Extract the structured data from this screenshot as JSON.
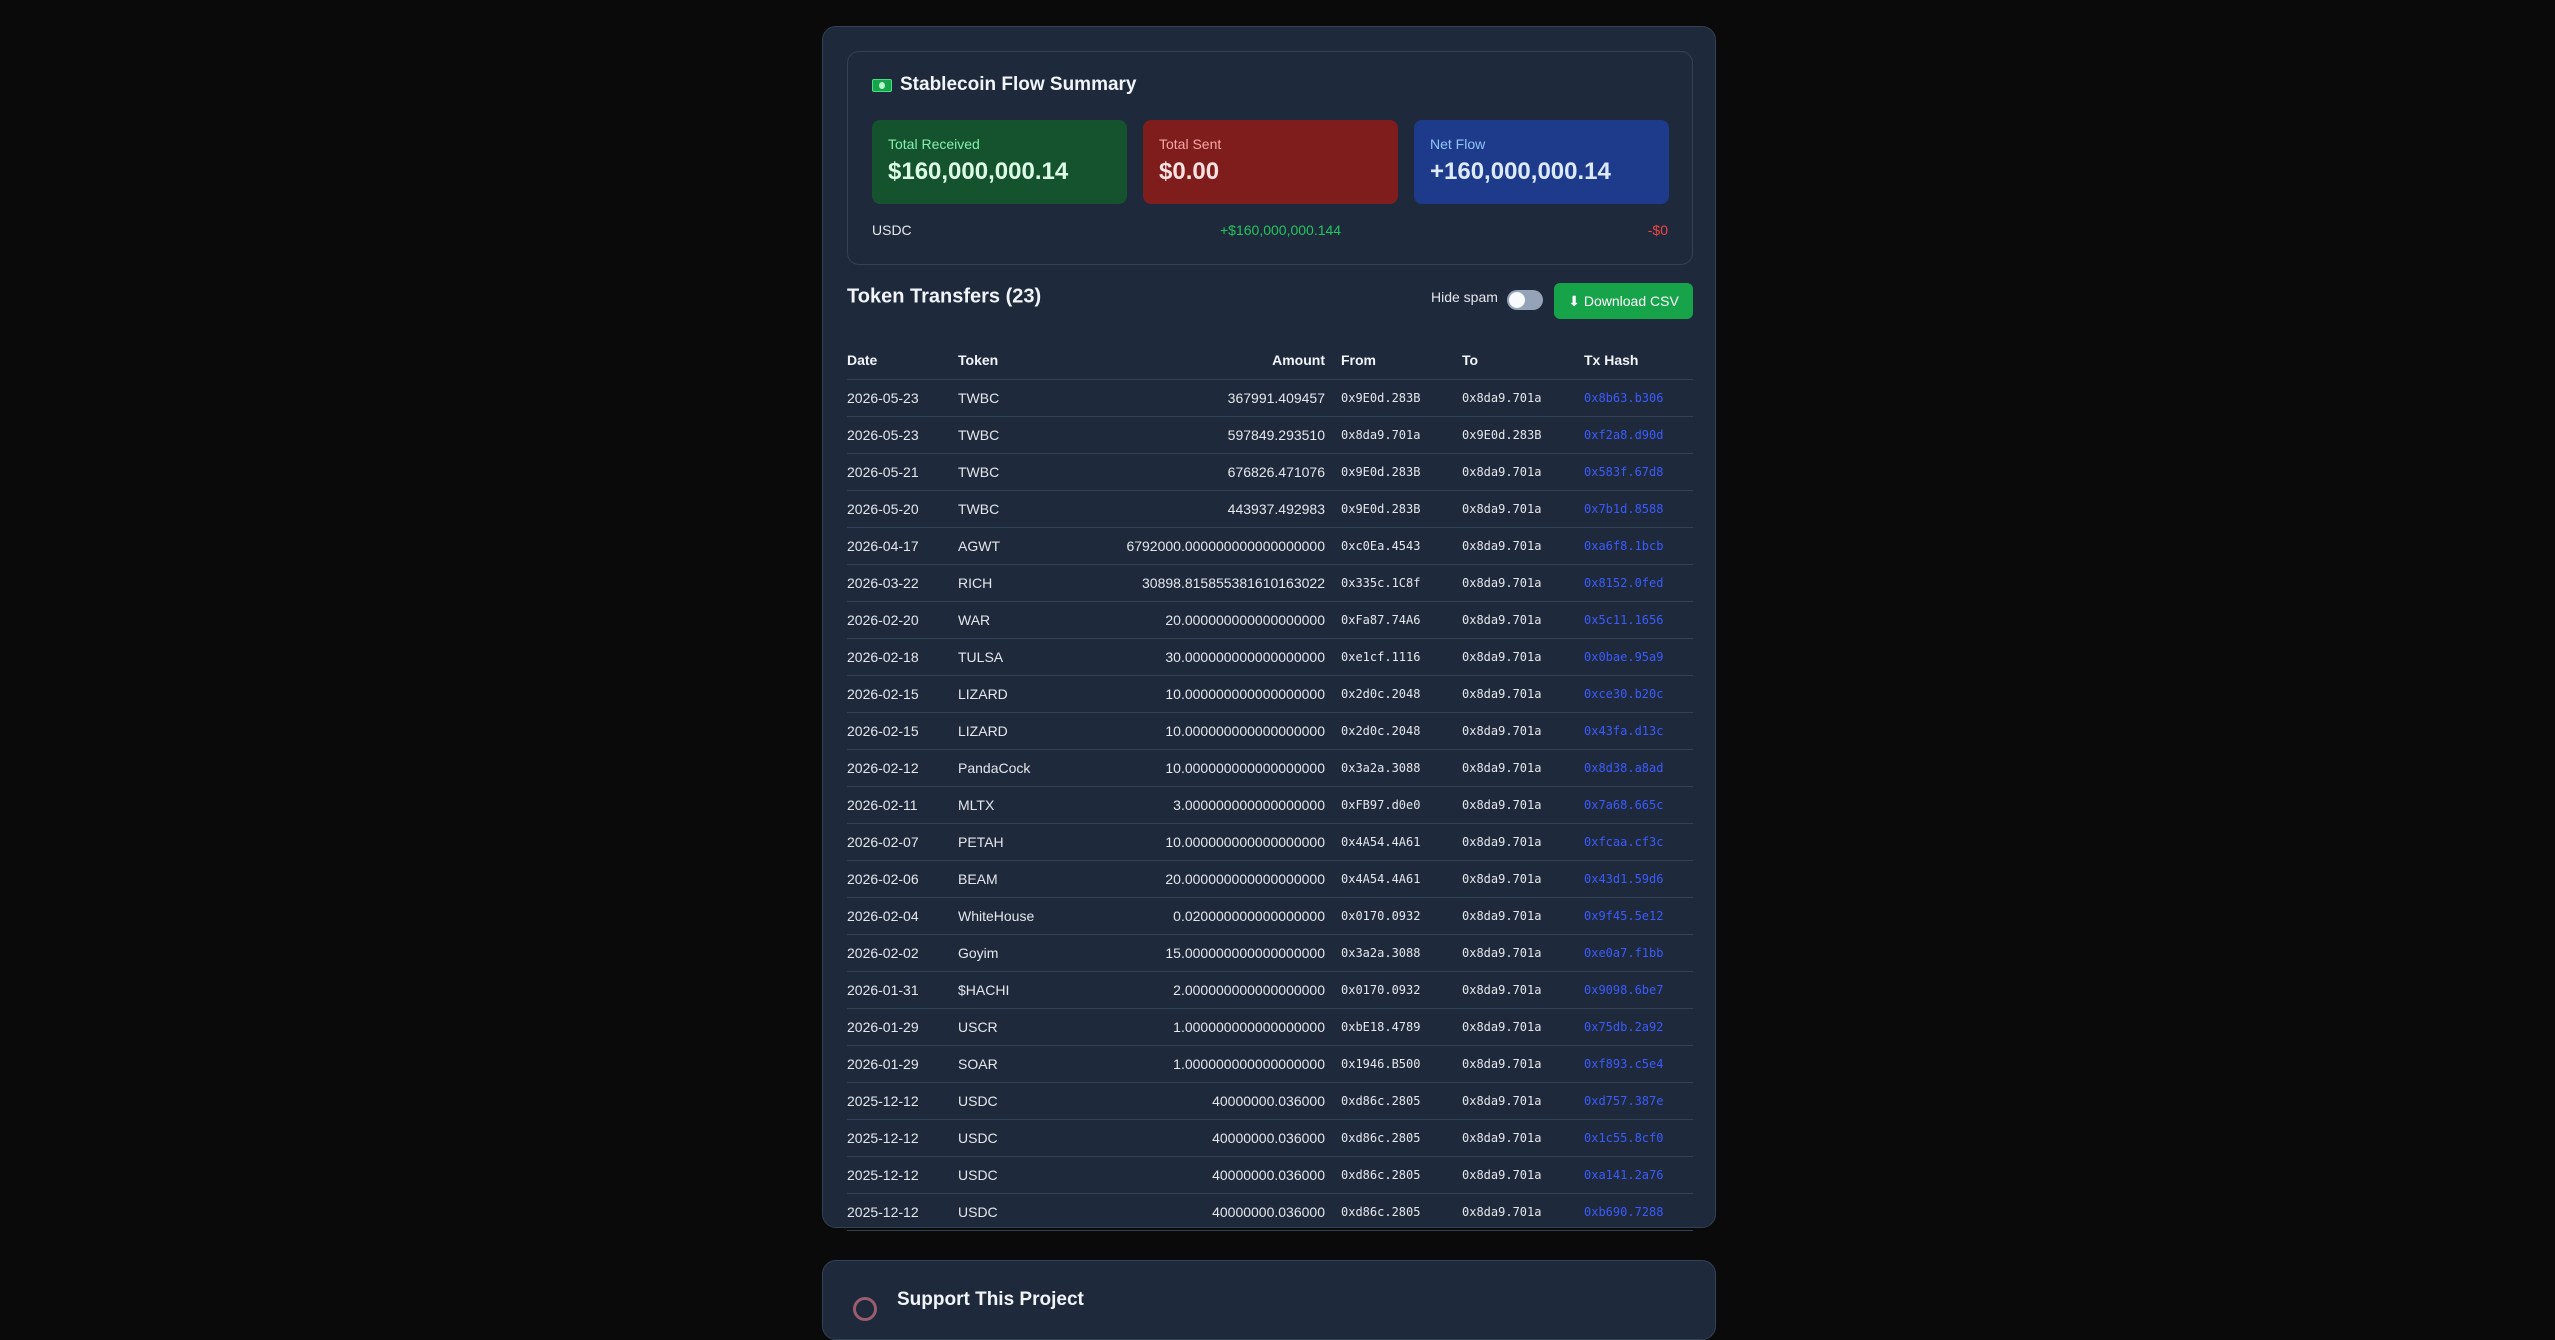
{
  "summary": {
    "title": "Stablecoin Flow Summary",
    "icon": "money-icon",
    "received": {
      "label": "Total Received",
      "value": "$160,000,000.14"
    },
    "sent": {
      "label": "Total Sent",
      "value": "$0.00"
    },
    "net": {
      "label": "Net Flow",
      "value": "+160,000,000.14"
    },
    "usdc": {
      "symbol": "USDC",
      "in": "+$160,000,000.144",
      "out": "-$0"
    }
  },
  "transfers": {
    "title": "Token Transfers (23)",
    "hide_spam_label": "Hide spam",
    "hide_spam_on": false,
    "download_label": "⬇ Download CSV",
    "columns": [
      "Date",
      "Token",
      "Amount",
      "From",
      "To",
      "Tx Hash"
    ],
    "rows": [
      {
        "date": "2026-05-23",
        "token": "TWBC",
        "amount": "367991.409457",
        "from": "0x9E0d.283B",
        "to": "0x8da9.701a",
        "hash": "0x8b63.b306"
      },
      {
        "date": "2026-05-23",
        "token": "TWBC",
        "amount": "597849.293510",
        "from": "0x8da9.701a",
        "to": "0x9E0d.283B",
        "hash": "0xf2a8.d90d"
      },
      {
        "date": "2026-05-21",
        "token": "TWBC",
        "amount": "676826.471076",
        "from": "0x9E0d.283B",
        "to": "0x8da9.701a",
        "hash": "0x583f.67d8"
      },
      {
        "date": "2026-05-20",
        "token": "TWBC",
        "amount": "443937.492983",
        "from": "0x9E0d.283B",
        "to": "0x8da9.701a",
        "hash": "0x7b1d.8588"
      },
      {
        "date": "2026-04-17",
        "token": "AGWT",
        "amount": "6792000.000000000000000000",
        "from": "0xc0Ea.4543",
        "to": "0x8da9.701a",
        "hash": "0xa6f8.1bcb"
      },
      {
        "date": "2026-03-22",
        "token": "RICH",
        "amount": "30898.815855381610163022",
        "from": "0x335c.1C8f",
        "to": "0x8da9.701a",
        "hash": "0x8152.0fed"
      },
      {
        "date": "2026-02-20",
        "token": "WAR",
        "amount": "20.000000000000000000",
        "from": "0xFa87.74A6",
        "to": "0x8da9.701a",
        "hash": "0x5c11.1656"
      },
      {
        "date": "2026-02-18",
        "token": "TULSA",
        "amount": "30.000000000000000000",
        "from": "0xe1cf.1116",
        "to": "0x8da9.701a",
        "hash": "0x0bae.95a9"
      },
      {
        "date": "2026-02-15",
        "token": "LIZARD",
        "amount": "10.000000000000000000",
        "from": "0x2d0c.2048",
        "to": "0x8da9.701a",
        "hash": "0xce30.b20c"
      },
      {
        "date": "2026-02-15",
        "token": "LIZARD",
        "amount": "10.000000000000000000",
        "from": "0x2d0c.2048",
        "to": "0x8da9.701a",
        "hash": "0x43fa.d13c"
      },
      {
        "date": "2026-02-12",
        "token": "PandaCock",
        "amount": "10.000000000000000000",
        "from": "0x3a2a.3088",
        "to": "0x8da9.701a",
        "hash": "0x8d38.a8ad"
      },
      {
        "date": "2026-02-11",
        "token": "MLTX",
        "amount": "3.000000000000000000",
        "from": "0xFB97.d0e0",
        "to": "0x8da9.701a",
        "hash": "0x7a68.665c"
      },
      {
        "date": "2026-02-07",
        "token": "PETAH",
        "amount": "10.000000000000000000",
        "from": "0x4A54.4A61",
        "to": "0x8da9.701a",
        "hash": "0xfcaa.cf3c"
      },
      {
        "date": "2026-02-06",
        "token": "BEAM",
        "amount": "20.000000000000000000",
        "from": "0x4A54.4A61",
        "to": "0x8da9.701a",
        "hash": "0x43d1.59d6"
      },
      {
        "date": "2026-02-04",
        "token": "WhiteHouse",
        "amount": "0.020000000000000000",
        "from": "0x0170.0932",
        "to": "0x8da9.701a",
        "hash": "0x9f45.5e12"
      },
      {
        "date": "2026-02-02",
        "token": "Goyim",
        "amount": "15.000000000000000000",
        "from": "0x3a2a.3088",
        "to": "0x8da9.701a",
        "hash": "0xe0a7.f1bb"
      },
      {
        "date": "2026-01-31",
        "token": "$HACHI",
        "amount": "2.000000000000000000",
        "from": "0x0170.0932",
        "to": "0x8da9.701a",
        "hash": "0x9098.6be7"
      },
      {
        "date": "2026-01-29",
        "token": "USCR",
        "amount": "1.000000000000000000",
        "from": "0xbE18.4789",
        "to": "0x8da9.701a",
        "hash": "0x75db.2a92"
      },
      {
        "date": "2026-01-29",
        "token": "SOAR",
        "amount": "1.000000000000000000",
        "from": "0x1946.B500",
        "to": "0x8da9.701a",
        "hash": "0xf893.c5e4"
      },
      {
        "date": "2025-12-12",
        "token": "USDC",
        "amount": "40000000.036000",
        "from": "0xd86c.2805",
        "to": "0x8da9.701a",
        "hash": "0xd757.387e"
      },
      {
        "date": "2025-12-12",
        "token": "USDC",
        "amount": "40000000.036000",
        "from": "0xd86c.2805",
        "to": "0x8da9.701a",
        "hash": "0x1c55.8cf0"
      },
      {
        "date": "2025-12-12",
        "token": "USDC",
        "amount": "40000000.036000",
        "from": "0xd86c.2805",
        "to": "0x8da9.701a",
        "hash": "0xa141.2a76"
      },
      {
        "date": "2025-12-12",
        "token": "USDC",
        "amount": "40000000.036000",
        "from": "0xd86c.2805",
        "to": "0x8da9.701a",
        "hash": "0xb690.7288"
      }
    ]
  },
  "support": {
    "title": "Support This Project",
    "icon": "heart-icon"
  },
  "colors": {
    "background": "#0a0a0a",
    "panel": "#1e293b",
    "received_card": "#14532d",
    "sent_card": "#7f1d1d",
    "net_card": "#1e3a8a",
    "download_button": "#16a34a",
    "hash_link": "#3b5bfd",
    "positive": "#22c55e",
    "negative": "#ef4444"
  }
}
